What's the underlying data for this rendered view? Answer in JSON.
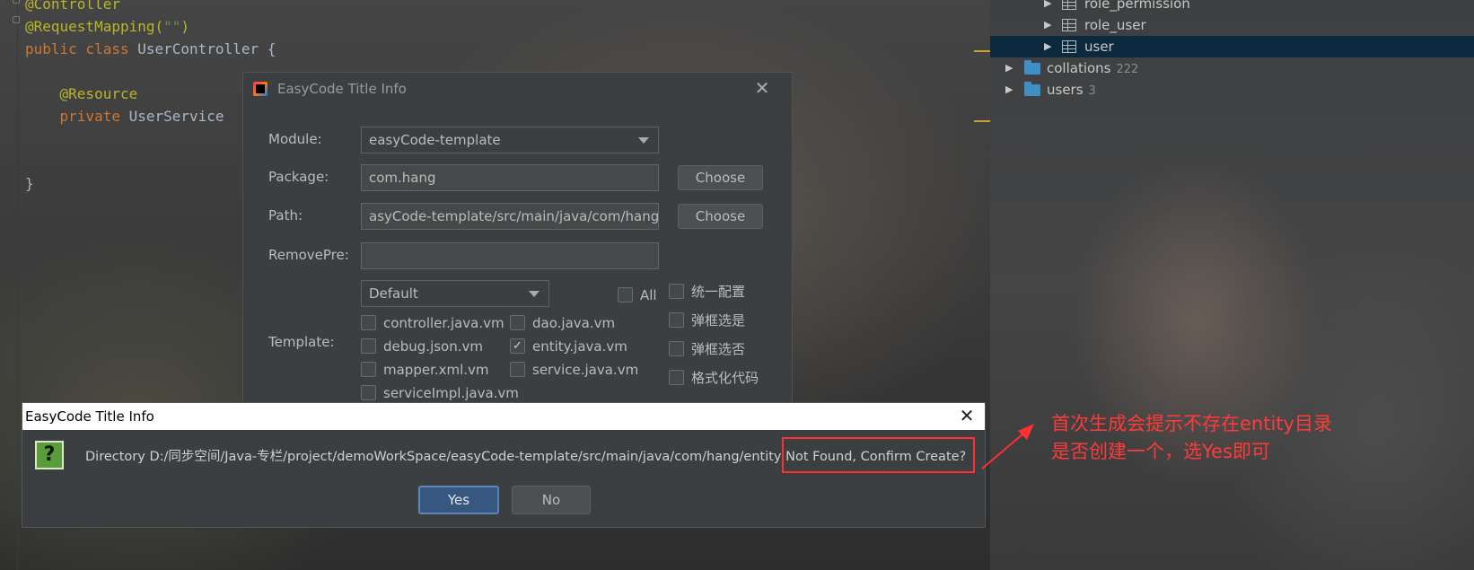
{
  "editor": {
    "lines": [
      {
        "parts": [
          {
            "t": "@Controller",
            "c": "anno"
          }
        ]
      },
      {
        "parts": [
          {
            "t": "@RequestMapping(",
            "c": "anno"
          },
          {
            "t": "\"\"",
            "c": "str"
          },
          {
            "t": ")",
            "c": "anno"
          }
        ]
      },
      {
        "parts": [
          {
            "t": "public class ",
            "c": "kw"
          },
          {
            "t": "UserController {",
            "c": ""
          }
        ]
      },
      {
        "parts": []
      },
      {
        "parts": [
          {
            "t": "    @Resource",
            "c": "anno"
          }
        ]
      },
      {
        "parts": [
          {
            "t": "    private ",
            "c": "kw"
          },
          {
            "t": "UserService",
            "c": ""
          }
        ]
      },
      {
        "parts": []
      },
      {
        "parts": []
      },
      {
        "parts": [
          {
            "t": "}",
            "c": ""
          }
        ]
      }
    ]
  },
  "db_tree": {
    "items": [
      {
        "label": "role_permission",
        "kind": "table",
        "count": ""
      },
      {
        "label": "role_user",
        "kind": "table",
        "count": ""
      },
      {
        "label": "user",
        "kind": "table",
        "count": "",
        "selected": true
      },
      {
        "label": "collations",
        "kind": "folder",
        "count": "222"
      },
      {
        "label": "users",
        "kind": "folder",
        "count": "3"
      }
    ]
  },
  "main_dialog": {
    "title": "EasyCode Title Info",
    "module_label": "Module:",
    "module_value": "easyCode-template",
    "package_label": "Package:",
    "package_value": "com.hang",
    "path_label": "Path:",
    "path_value": "asyCode-template/src/main/java/com/hang",
    "removepre_label": "RemovePre:",
    "removepre_value": "",
    "choose_label": "Choose",
    "template_label": "Template:",
    "template_group": "Default",
    "all_label": "All",
    "templates": [
      {
        "name": "controller.java.vm",
        "checked": false
      },
      {
        "name": "dao.java.vm",
        "checked": false
      },
      {
        "name": "debug.json.vm",
        "checked": false
      },
      {
        "name": "entity.java.vm",
        "checked": true
      },
      {
        "name": "mapper.xml.vm",
        "checked": false
      },
      {
        "name": "service.java.vm",
        "checked": false
      },
      {
        "name": "serviceImpl.java.vm",
        "checked": false
      }
    ],
    "options": [
      {
        "name": "统一配置",
        "checked": false
      },
      {
        "name": "弹框选是",
        "checked": false
      },
      {
        "name": "弹框选否",
        "checked": false
      },
      {
        "name": "格式化代码",
        "checked": false
      }
    ]
  },
  "confirm_dialog": {
    "title": "EasyCode Title Info",
    "icon": "question-icon",
    "message": "Directory D:/同步空间/Java-专栏/project/demoWorkSpace/easyCode-template/src/main/java/com/hang/entity Not Found, Confirm Create?",
    "yes_label": "Yes",
    "no_label": "No"
  },
  "annotation": {
    "text_line1": "首次生成会提示不存在entity目录",
    "text_line2": "是否创建一个，选Yes即可",
    "color": "#ff3a3a"
  },
  "colors": {
    "annotation_red": "#ff3030",
    "yes_button": "#365880",
    "selected_row": "#0d293e",
    "folder": "#3d8fc6"
  }
}
